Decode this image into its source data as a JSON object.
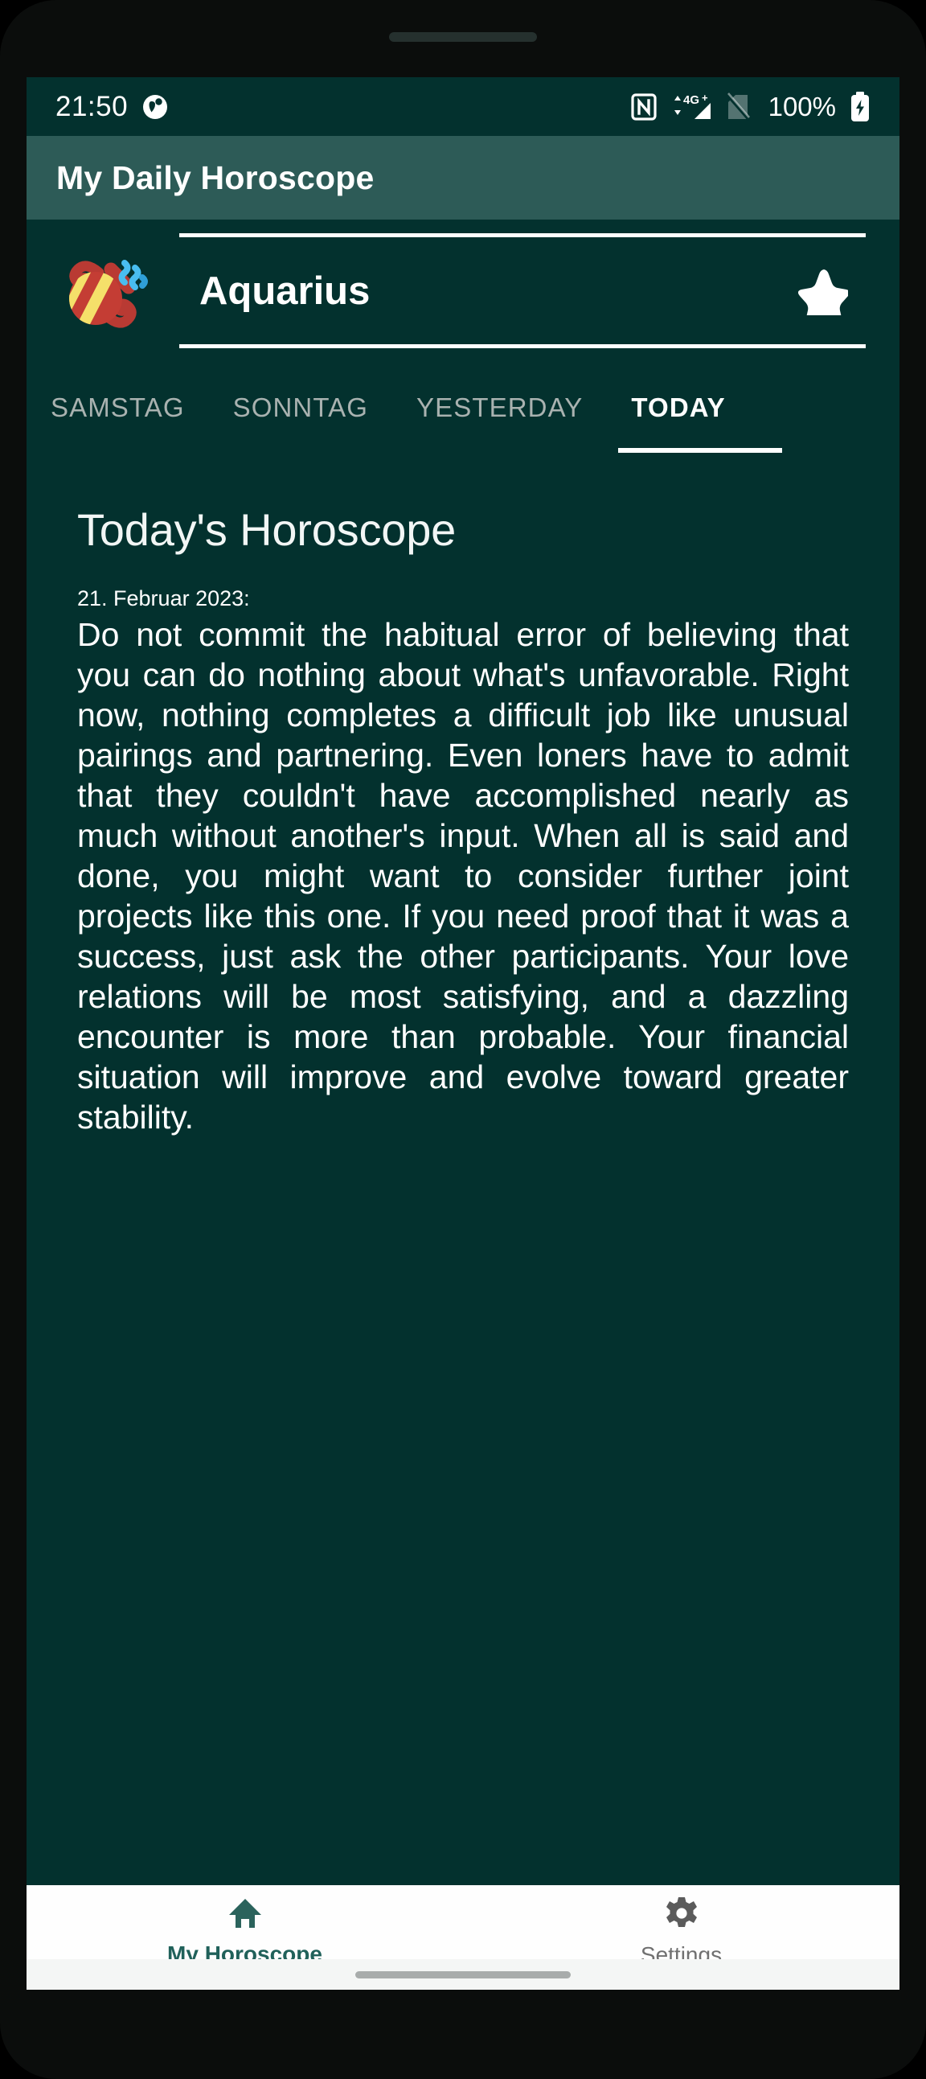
{
  "statusbar": {
    "time": "21:50",
    "left_icon": "circle-figure-icon",
    "icons": [
      {
        "name": "nfc-icon",
        "label": "NFC"
      },
      {
        "name": "mobile-data-4g-plus-icon",
        "label": "4G+"
      },
      {
        "name": "sim-disabled-icon",
        "label": "no SIM"
      }
    ],
    "battery_percent": "100%",
    "battery_icon": "battery-charging-icon"
  },
  "appbar": {
    "title": "My Daily Horoscope"
  },
  "sign_selector": {
    "emoji_name": "aquarius-zodiac-icon",
    "sign": "Aquarius",
    "favorite_icon": "star-icon"
  },
  "tabs": [
    {
      "label": "SAMSTAG",
      "active": false
    },
    {
      "label": "SONNTAG",
      "active": false
    },
    {
      "label": "YESTERDAY",
      "active": false
    },
    {
      "label": "TODAY",
      "active": true
    }
  ],
  "main": {
    "title": "Today's Horoscope",
    "date": "21. Februar 2023:",
    "body": "Do not commit the habitual error of believing that you can do nothing about what's unfavorable. Right now, nothing completes a difficult job like unusual pairings and partnering. Even loners have to admit that they couldn't have accomplished nearly as much without another's input. When all is said and done, you might want to consider further joint projects like this one. If you need proof that it was a success, just ask the other participants. Your love relations will be most satisfying, and a dazzling encounter is more than probable. Your financial situation will improve and evolve toward greater stability."
  },
  "bottomnav": [
    {
      "label": "My Horoscope",
      "icon": "home-icon",
      "active": true
    },
    {
      "label": "Settings",
      "icon": "gear-icon",
      "active": false
    }
  ],
  "colors": {
    "screen_bg": "#03312e",
    "appbar_bg": "#2d5b57",
    "accent": "#20615a",
    "inactive_tab": "#a9b2b0",
    "nav_bg": "#fefefe"
  }
}
